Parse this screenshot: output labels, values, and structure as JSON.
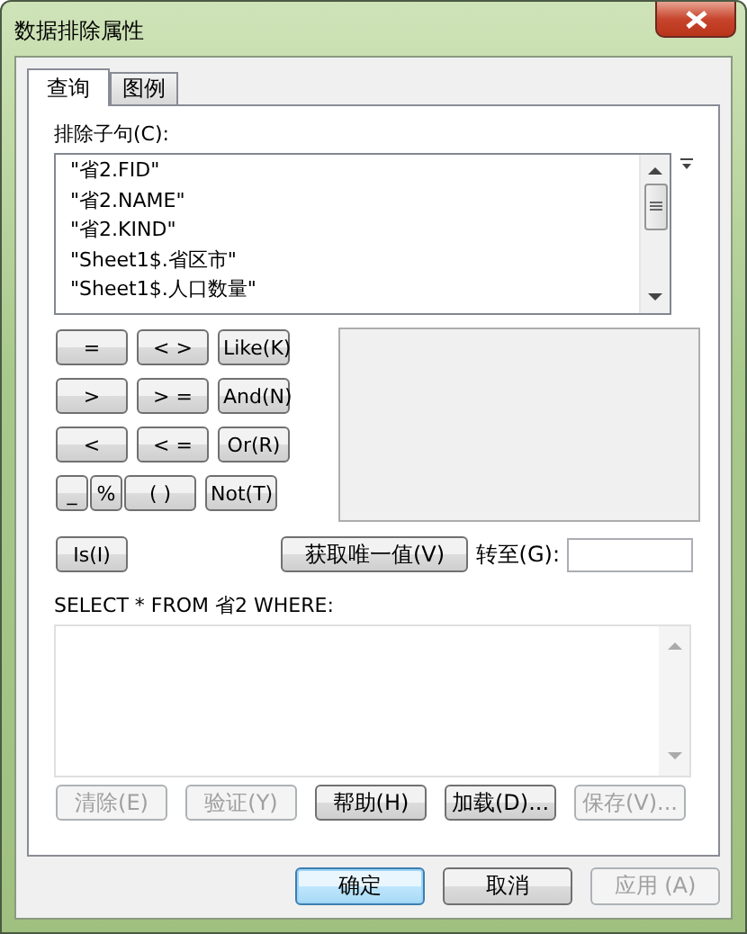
{
  "window": {
    "title": "数据排除属性"
  },
  "tabs": [
    {
      "label": "查询",
      "selected": true
    },
    {
      "label": "图例",
      "selected": false
    }
  ],
  "clause_label": "排除子句(C):",
  "fields": [
    "\"省2.FID\"",
    "\"省2.NAME\"",
    "\"省2.KIND\"",
    "\"Sheet1$.省区市\"",
    "\"Sheet1$.人口数量\""
  ],
  "operator_rows": [
    [
      {
        "label": "=",
        "kind": "normal"
      },
      {
        "label": "< >",
        "kind": "normal"
      },
      {
        "label": "Like(K)",
        "kind": "normal"
      }
    ],
    [
      {
        "label": ">",
        "kind": "normal"
      },
      {
        "label": "> =",
        "kind": "normal"
      },
      {
        "label": "And(N)",
        "kind": "normal"
      }
    ],
    [
      {
        "label": "<",
        "kind": "normal"
      },
      {
        "label": "< =",
        "kind": "normal"
      },
      {
        "label": "Or(R)",
        "kind": "normal"
      }
    ],
    [
      {
        "label": "_",
        "kind": "half"
      },
      {
        "label": "%",
        "kind": "half"
      },
      {
        "label": "( )",
        "kind": "normal"
      },
      {
        "label": "Not(T)",
        "kind": "normal"
      }
    ]
  ],
  "is_button": "Is(I)",
  "unique_button": "获取唯一值(V)",
  "goto_label": "转至(G):",
  "sql_label": "SELECT * FROM 省2 WHERE:",
  "actions": [
    {
      "label": "清除(E)",
      "disabled": true
    },
    {
      "label": "验证(Y)",
      "disabled": true
    },
    {
      "label": "帮助(H)",
      "disabled": false
    },
    {
      "label": "加载(D)...",
      "disabled": false
    },
    {
      "label": "保存(V)...",
      "disabled": true
    }
  ],
  "dialog_buttons": [
    {
      "label": "确定",
      "disabled": false,
      "default": true
    },
    {
      "label": "取消",
      "disabled": false,
      "default": false
    },
    {
      "label": "应用 (A)",
      "disabled": true,
      "default": false
    }
  ]
}
